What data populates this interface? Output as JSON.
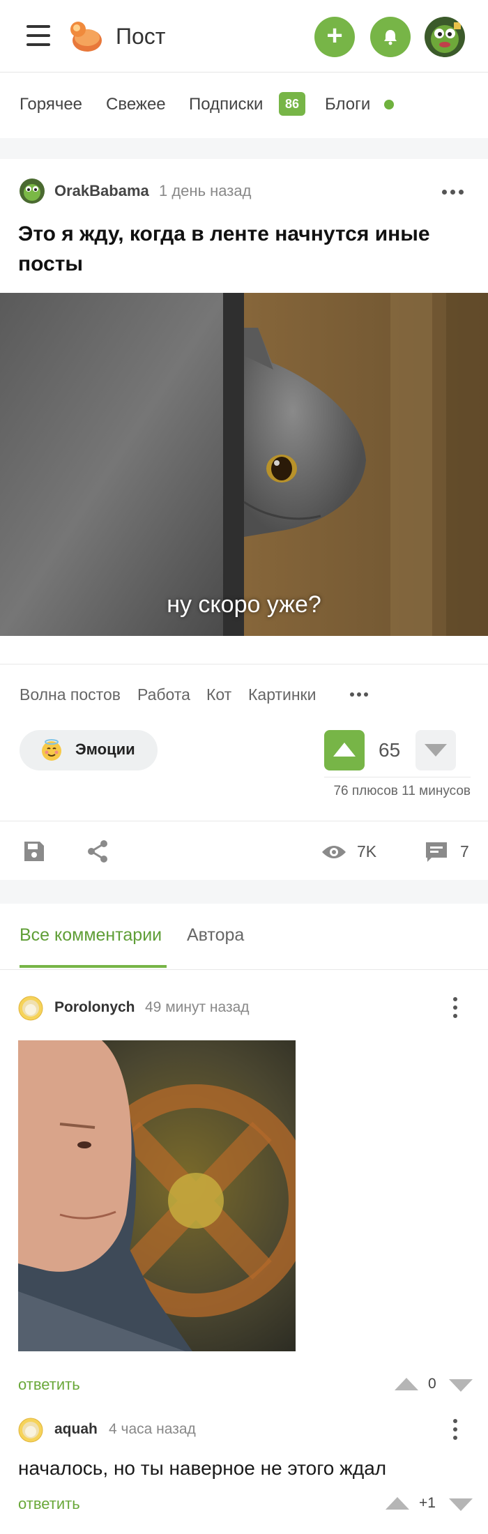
{
  "header": {
    "title": "Пост",
    "menu_icon": "hamburger-icon",
    "add_icon": "plus-icon",
    "notification_icon": "bell-icon",
    "accent_color": "#77b547"
  },
  "nav": {
    "items": [
      {
        "label": "Горячее"
      },
      {
        "label": "Свежее"
      },
      {
        "label": "Подписки",
        "badge": "86"
      },
      {
        "label": "Блоги"
      }
    ]
  },
  "post": {
    "author": "OrakBabama",
    "time": "1 день назад",
    "title": "Это я жду, когда в ленте начнутся иные посты",
    "image_caption": "ну скоро уже?",
    "tags": [
      "Волна постов",
      "Работа",
      "Кот",
      "Картинки"
    ],
    "emotions_label": "Эмоции",
    "rating": "65",
    "votes_summary": "76 плюсов 11 минусов",
    "views": "7K",
    "comments_count": "7"
  },
  "comments_tabs": {
    "all": "Все комментарии",
    "author": "Автора"
  },
  "comments": [
    {
      "author": "Porolonych",
      "time": "49 минут назад",
      "reply_label": "ответить",
      "score": "0"
    },
    {
      "author": "aquah",
      "time": "4 часа назад",
      "text": "началось, но ты наверное не этого ждал",
      "reply_label": "ответить",
      "score": "+1"
    }
  ]
}
